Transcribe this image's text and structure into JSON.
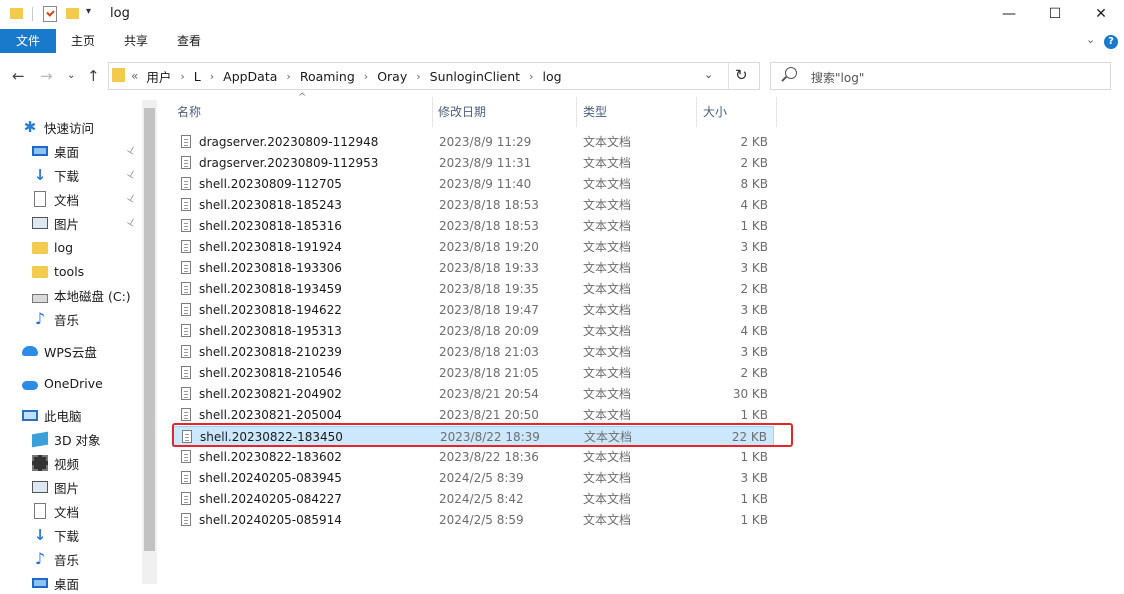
{
  "window": {
    "title": "log",
    "minimize": "—",
    "maximize": "☐",
    "close": "✕"
  },
  "ribbon": {
    "tabs": [
      "文件",
      "主页",
      "共享",
      "查看"
    ],
    "collapse": "⌄",
    "help": "?"
  },
  "nav": {
    "back": "←",
    "forward": "→",
    "recent": "⌄",
    "up": "↑",
    "lead": "«",
    "breadcrumb": [
      "用户",
      "L",
      "AppData",
      "Roaming",
      "Oray",
      "SunloginClient",
      "log"
    ],
    "sep": "›",
    "dropdown": "⌄",
    "refresh": "↻",
    "search_placeholder": "搜索\"log\""
  },
  "sidebar": {
    "items": [
      {
        "label": "快速访问",
        "icon": "star-icon",
        "pinned": false
      },
      {
        "label": "桌面",
        "icon": "desktop-icon",
        "pinned": true
      },
      {
        "label": "下载",
        "icon": "download-icon",
        "pinned": true
      },
      {
        "label": "文档",
        "icon": "document-icon",
        "pinned": true
      },
      {
        "label": "图片",
        "icon": "pictures-icon",
        "pinned": true
      },
      {
        "label": "log",
        "icon": "folder-icon",
        "pinned": false
      },
      {
        "label": "tools",
        "icon": "folder-icon",
        "pinned": false
      },
      {
        "label": "本地磁盘 (C:)",
        "icon": "drive-icon",
        "pinned": false
      },
      {
        "label": "音乐",
        "icon": "music-icon",
        "pinned": false
      },
      {
        "label": "WPS云盘",
        "icon": "wps-cloud-icon",
        "pinned": false
      },
      {
        "label": "OneDrive",
        "icon": "onedrive-icon",
        "pinned": false
      },
      {
        "label": "此电脑",
        "icon": "pc-icon",
        "pinned": false
      },
      {
        "label": "3D 对象",
        "icon": "3d-objects-icon",
        "pinned": false
      },
      {
        "label": "视频",
        "icon": "video-icon",
        "pinned": false
      },
      {
        "label": "图片",
        "icon": "pictures-icon",
        "pinned": false
      },
      {
        "label": "文档",
        "icon": "document-icon",
        "pinned": false
      },
      {
        "label": "下载",
        "icon": "download-icon",
        "pinned": false
      },
      {
        "label": "音乐",
        "icon": "music-icon",
        "pinned": false
      },
      {
        "label": "桌面",
        "icon": "desktop-icon",
        "pinned": false
      }
    ],
    "pin_glyph": "📌"
  },
  "columns": {
    "name": "名称",
    "date": "修改日期",
    "type": "类型",
    "size": "大小",
    "sort_caret": "^"
  },
  "files": [
    {
      "name": "dragserver.20230809-112948",
      "date": "2023/8/9 11:29",
      "type": "文本文档",
      "size": "2 KB"
    },
    {
      "name": "dragserver.20230809-112953",
      "date": "2023/8/9 11:31",
      "type": "文本文档",
      "size": "2 KB"
    },
    {
      "name": "shell.20230809-112705",
      "date": "2023/8/9 11:40",
      "type": "文本文档",
      "size": "8 KB"
    },
    {
      "name": "shell.20230818-185243",
      "date": "2023/8/18 18:53",
      "type": "文本文档",
      "size": "4 KB"
    },
    {
      "name": "shell.20230818-185316",
      "date": "2023/8/18 18:53",
      "type": "文本文档",
      "size": "1 KB"
    },
    {
      "name": "shell.20230818-191924",
      "date": "2023/8/18 19:20",
      "type": "文本文档",
      "size": "3 KB"
    },
    {
      "name": "shell.20230818-193306",
      "date": "2023/8/18 19:33",
      "type": "文本文档",
      "size": "3 KB"
    },
    {
      "name": "shell.20230818-193459",
      "date": "2023/8/18 19:35",
      "type": "文本文档",
      "size": "2 KB"
    },
    {
      "name": "shell.20230818-194622",
      "date": "2023/8/18 19:47",
      "type": "文本文档",
      "size": "3 KB"
    },
    {
      "name": "shell.20230818-195313",
      "date": "2023/8/18 20:09",
      "type": "文本文档",
      "size": "4 KB"
    },
    {
      "name": "shell.20230818-210239",
      "date": "2023/8/18 21:03",
      "type": "文本文档",
      "size": "3 KB"
    },
    {
      "name": "shell.20230818-210546",
      "date": "2023/8/18 21:05",
      "type": "文本文档",
      "size": "2 KB"
    },
    {
      "name": "shell.20230821-204902",
      "date": "2023/8/21 20:54",
      "type": "文本文档",
      "size": "30 KB"
    },
    {
      "name": "shell.20230821-205004",
      "date": "2023/8/21 20:50",
      "type": "文本文档",
      "size": "1 KB"
    },
    {
      "name": "shell.20230822-183450",
      "date": "2023/8/22 18:39",
      "type": "文本文档",
      "size": "22 KB",
      "selected": true
    },
    {
      "name": "shell.20230822-183602",
      "date": "2023/8/22 18:36",
      "type": "文本文档",
      "size": "1 KB"
    },
    {
      "name": "shell.20240205-083945",
      "date": "2024/2/5 8:39",
      "type": "文本文档",
      "size": "3 KB"
    },
    {
      "name": "shell.20240205-084227",
      "date": "2024/2/5 8:42",
      "type": "文本文档",
      "size": "1 KB"
    },
    {
      "name": "shell.20240205-085914",
      "date": "2024/2/5 8:59",
      "type": "文本文档",
      "size": "1 KB"
    }
  ],
  "colors": {
    "accent": "#1979ca",
    "selection": "#cce8ff",
    "highlight_border": "#e3262c"
  }
}
